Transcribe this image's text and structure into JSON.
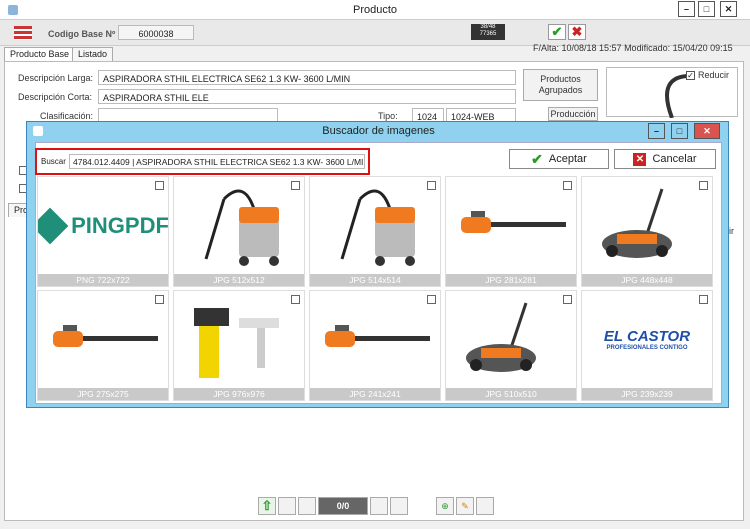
{
  "window": {
    "title": "Producto",
    "min": "–",
    "max": "□",
    "close": "✕"
  },
  "toolbar": {
    "codigo_label": "Codigo Base Nº",
    "codigo_value": "6000038",
    "counter_top": "38/48",
    "counter_bottom": "77365",
    "fechas": "F/Alta: 10/08/18 15:57 Modificado: 15/04/20 09:15"
  },
  "tabs": [
    "Producto Base",
    "Listado"
  ],
  "form": {
    "desc_larga_label": "Descripción Larga:",
    "desc_larga_value": "ASPIRADORA STHIL ELECTRICA SE62 1.3 KW- 3600 L/MIN",
    "desc_corta_label": "Descripción Corta:",
    "desc_corta_value": "ASPIRADORA STHIL ELE",
    "clasificacion_label": "Clasificación:",
    "tipo_label": "Tipo:",
    "tipo_code": "1024",
    "tipo_value": "1024-WEB",
    "produccion_label": "Producción",
    "agrupados_label": "Productos Agrupados",
    "reducir_label": "Reducir",
    "side_tab": "Pro",
    "side_tab_right": "ir"
  },
  "modal": {
    "title": "Buscador de imagenes",
    "search_label": "Buscar",
    "search_value": "4784.012.4409 | ASPIRADORA STHIL ELECTRICA SE62 1.3 KW- 3600 L/MIN",
    "aceptar": "Aceptar",
    "cancelar": "Cancelar",
    "images": [
      {
        "caption": "PNG 722x722",
        "icon": "pingpdf-logo",
        "logo_text": "PINGPDF"
      },
      {
        "caption": "JPG 512x512",
        "icon": "vacuum-image"
      },
      {
        "caption": "JPG 514x514",
        "icon": "vacuum-image"
      },
      {
        "caption": "JPG 281x281",
        "icon": "hedge-trimmer-image"
      },
      {
        "caption": "JPG 448x448",
        "icon": "sweeper-image"
      },
      {
        "caption": "JPG 275x275",
        "icon": "hedge-trimmer-image"
      },
      {
        "caption": "JPG 976x976",
        "icon": "window-vac-image"
      },
      {
        "caption": "JPG 241x241",
        "icon": "hedge-trimmer-image"
      },
      {
        "caption": "JPG 510x510",
        "icon": "sweeper-image"
      },
      {
        "caption": "JPG 239x239",
        "icon": "elcastor-logo",
        "logo_text": "EL CASTOR",
        "logo_sub": "PROFESIONALES CONTIGO"
      }
    ]
  },
  "pager": {
    "value": "0/0"
  },
  "colors": {
    "modal_bg": "#8fd1ee",
    "highlight": "#dd1111",
    "accept_green": "#2a9a2a",
    "cancel_red": "#cc2222"
  }
}
